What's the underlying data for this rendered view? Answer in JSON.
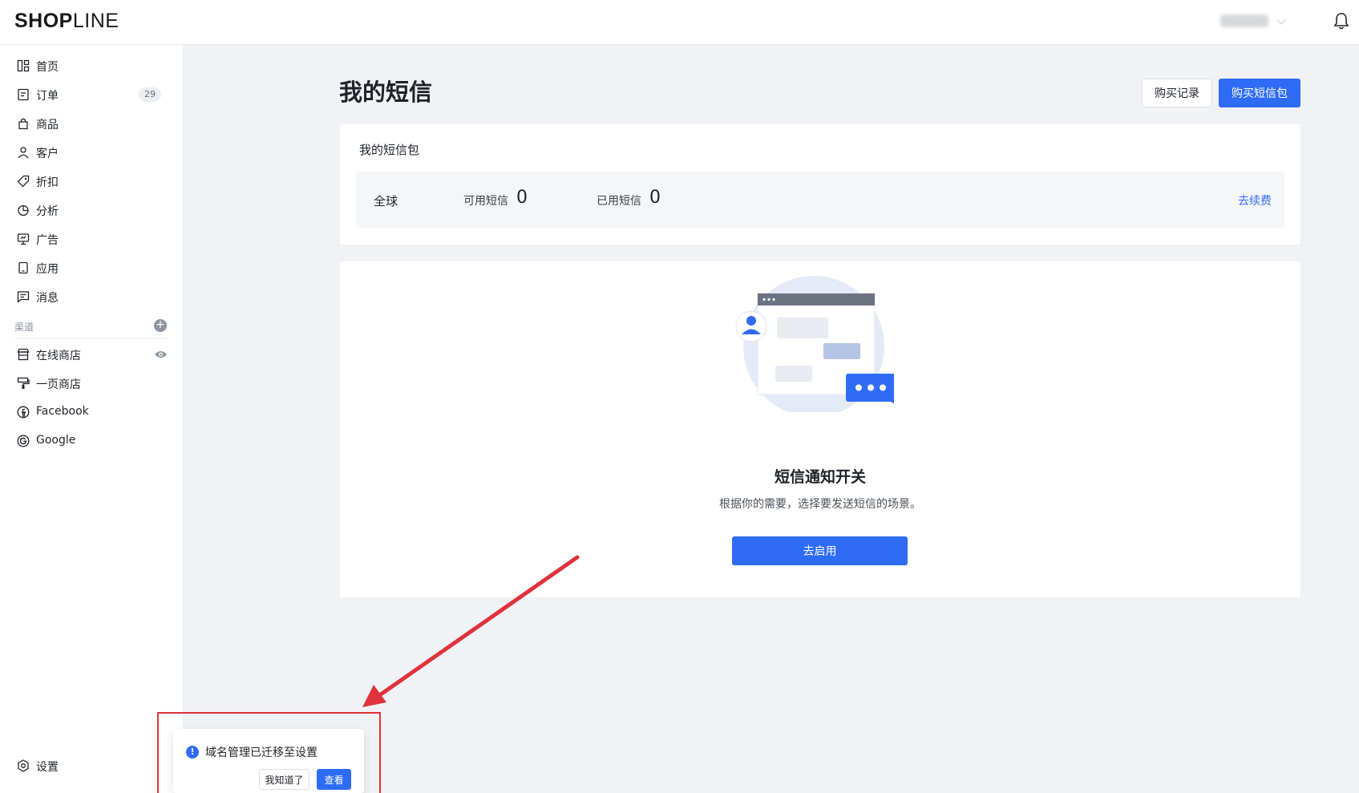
{
  "brand": {
    "logo_bold": "SHOP",
    "logo_light": "LINE"
  },
  "sidebar": {
    "items": [
      {
        "label": "首页",
        "icon": "dashboard-icon"
      },
      {
        "label": "订单",
        "icon": "order-icon",
        "badge": "29"
      },
      {
        "label": "商品",
        "icon": "product-bag-icon"
      },
      {
        "label": "客户",
        "icon": "customer-icon"
      },
      {
        "label": "折扣",
        "icon": "tag-icon"
      },
      {
        "label": "分析",
        "icon": "chart-pie-icon"
      },
      {
        "label": "广告",
        "icon": "ad-screen-icon"
      },
      {
        "label": "应用",
        "icon": "app-icon"
      },
      {
        "label": "消息",
        "icon": "message-icon"
      }
    ],
    "channel_section": "渠道",
    "channels": [
      {
        "label": "在线商店",
        "icon": "store-icon"
      },
      {
        "label": "一页商店",
        "icon": "brush-icon"
      },
      {
        "label": "Facebook",
        "icon": "facebook-icon"
      },
      {
        "label": "Google",
        "icon": "google-icon"
      }
    ],
    "settings_label": "设置"
  },
  "header": {
    "title": "我的短信",
    "history_button": "购买记录",
    "buy_button": "购买短信包"
  },
  "package": {
    "title": "我的短信包",
    "region": "全球",
    "available_label": "可用短信",
    "available_value": "0",
    "used_label": "已用短信",
    "used_value": "0",
    "renew_link": "去续费"
  },
  "notify": {
    "title": "短信通知开关",
    "description": "根据你的需要，选择要发送短信的场景。",
    "enable_button": "去启用"
  },
  "toast": {
    "message": "域名管理已迁移至设置",
    "dismiss_button": "我知道了",
    "view_button": "查看"
  },
  "colors": {
    "primary": "#2e6cf6",
    "annotation": "#e0323a"
  }
}
